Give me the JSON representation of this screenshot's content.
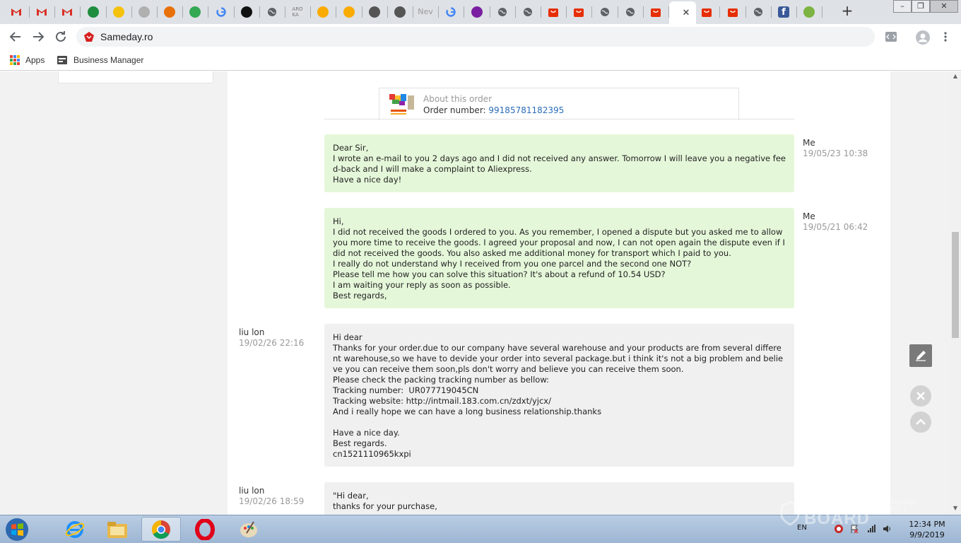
{
  "tabs": [
    {
      "icon": "gmail-icon",
      "color": "#d93025"
    },
    {
      "icon": "gmail-icon",
      "color": "#d93025"
    },
    {
      "icon": "gmail-icon",
      "color": "#d93025"
    },
    {
      "icon": "green-circle-icon",
      "color": "#1e8e3e"
    },
    {
      "icon": "yellow-note-icon",
      "color": "#f4c20d"
    },
    {
      "icon": "bird-icon",
      "color": "#b0b0b0"
    },
    {
      "icon": "balloon-icon",
      "color": "#e8710a"
    },
    {
      "icon": "heart-icon",
      "color": "#34a853"
    },
    {
      "icon": "google-icon",
      "color": "#4285f4"
    },
    {
      "icon": "dark-circle-icon",
      "color": "#111111"
    },
    {
      "icon": "globe-icon",
      "color": "#5f6368"
    },
    {
      "icon": "text-logo-icon",
      "color": "#777777",
      "text": "ARO\nKA"
    },
    {
      "icon": "ticket-icon",
      "color": "#f9ab00"
    },
    {
      "icon": "ticket-icon",
      "color": "#f9ab00"
    },
    {
      "icon": "bottle-icon",
      "color": "#555555"
    },
    {
      "icon": "asterisk-icon",
      "color": "#555555"
    },
    {
      "icon": "newtab-text-icon",
      "color": "#999999",
      "text": "Nev"
    },
    {
      "icon": "google-icon",
      "color": "#4285f4"
    },
    {
      "icon": "purple-logo-icon",
      "color": "#7b1fa2"
    },
    {
      "icon": "globe-icon",
      "color": "#5f6368"
    },
    {
      "icon": "globe-icon",
      "color": "#5f6368"
    },
    {
      "icon": "aliexpress-icon",
      "color": "#e62e04"
    },
    {
      "icon": "aliexpress-icon",
      "color": "#e62e04"
    },
    {
      "icon": "globe-icon",
      "color": "#5f6368"
    },
    {
      "icon": "globe-icon",
      "color": "#5f6368"
    },
    {
      "icon": "aliexpress-icon",
      "color": "#e62e04"
    },
    {
      "icon": "active-tab",
      "color": "#ffffff",
      "active": true
    },
    {
      "icon": "aliexpress-icon",
      "color": "#e62e04"
    },
    {
      "icon": "aliexpress-icon",
      "color": "#e62e04"
    },
    {
      "icon": "globe-icon",
      "color": "#5f6368"
    },
    {
      "icon": "facebook-icon",
      "color": "#3b5998"
    },
    {
      "icon": "green-badge-icon",
      "color": "#7cb342"
    }
  ],
  "browser": {
    "url": "Sameday.ro",
    "bookmarks": [
      {
        "label": "Apps"
      },
      {
        "label": "Business Manager"
      }
    ]
  },
  "order": {
    "caption": "About this order",
    "number_label": "Order number: ",
    "number": "99185781182395"
  },
  "messages": [
    {
      "sender": "Me",
      "time": "19/05/23 10:38",
      "side": "me",
      "text": "Dear Sir,\nI wrote an e-mail to you 2 days ago and I did not received any answer. Tomorrow I will leave you a negative feed-back and I will make a complaint to Aliexpress.\nHave a nice day!"
    },
    {
      "sender": "Me",
      "time": "19/05/21 06:42",
      "side": "me",
      "text": "Hi,\nI did not received the goods I ordered to you. As you remember, I opened a dispute but you asked me to allow you more time to receive the goods. I agreed your proposal and now, I can not open again the dispute even if I did not received the goods. You also asked me additional money for transport which I paid to you.\nI really do not understand why I received from you one parcel and the second one NOT?\nPlease tell me how you can solve this situation? It's about a refund of 10.54 USD?\nI am waiting your reply as soon as possible.\nBest regards,"
    },
    {
      "sender": "liu lon",
      "time": "19/02/26 22:16",
      "side": "them",
      "text": "Hi dear\nThanks for your order.due to our company have several warehouse and your products are from several different warehouse,so we have to devide your order into several package.but i think it's not a big problem and believe you can receive them soon,pls don't worry and believe you can receive them soon.\nPlease check the packing tracking number as bellow:\nTracking number:  UR077719045CN\nTracking website: http://intmail.183.com.cn/zdxt/yjcx/\nAnd i really hope we can have a long business relationship.thanks\n\nHave a nice day.\nBest regards.\ncn1521110965kxpi"
    },
    {
      "sender": "liu lon",
      "time": "19/02/26 18:59",
      "side": "them",
      "text": "\"Hi dear,\nthanks for your purchase,"
    }
  ],
  "taskbar": {
    "apps": [
      {
        "icon": "internet-explorer-icon"
      },
      {
        "icon": "file-explorer-icon"
      },
      {
        "icon": "chrome-icon",
        "active": true
      },
      {
        "icon": "opera-icon"
      },
      {
        "icon": "paint-icon"
      }
    ],
    "language": "EN",
    "time": "12:34 PM",
    "date": "9/9/2019"
  },
  "watermark": {
    "text": "BOARD",
    "tag": "RESOLVING\nSINCE 2"
  }
}
